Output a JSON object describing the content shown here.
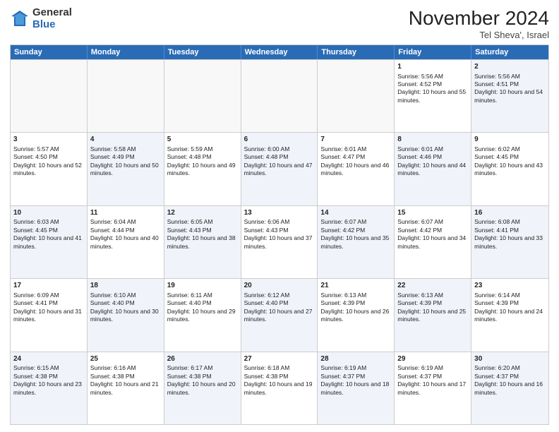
{
  "header": {
    "logo_general": "General",
    "logo_blue": "Blue",
    "title": "November 2024",
    "subtitle": "Tel Sheva', Israel"
  },
  "weekdays": [
    "Sunday",
    "Monday",
    "Tuesday",
    "Wednesday",
    "Thursday",
    "Friday",
    "Saturday"
  ],
  "rows": [
    [
      {
        "day": "",
        "info": "",
        "empty": true
      },
      {
        "day": "",
        "info": "",
        "empty": true
      },
      {
        "day": "",
        "info": "",
        "empty": true
      },
      {
        "day": "",
        "info": "",
        "empty": true
      },
      {
        "day": "",
        "info": "",
        "empty": true
      },
      {
        "day": "1",
        "info": "Sunrise: 5:56 AM\nSunset: 4:52 PM\nDaylight: 10 hours and 55 minutes.",
        "empty": false,
        "alt": false
      },
      {
        "day": "2",
        "info": "Sunrise: 5:56 AM\nSunset: 4:51 PM\nDaylight: 10 hours and 54 minutes.",
        "empty": false,
        "alt": true
      }
    ],
    [
      {
        "day": "3",
        "info": "Sunrise: 5:57 AM\nSunset: 4:50 PM\nDaylight: 10 hours and 52 minutes.",
        "empty": false,
        "alt": false
      },
      {
        "day": "4",
        "info": "Sunrise: 5:58 AM\nSunset: 4:49 PM\nDaylight: 10 hours and 50 minutes.",
        "empty": false,
        "alt": true
      },
      {
        "day": "5",
        "info": "Sunrise: 5:59 AM\nSunset: 4:48 PM\nDaylight: 10 hours and 49 minutes.",
        "empty": false,
        "alt": false
      },
      {
        "day": "6",
        "info": "Sunrise: 6:00 AM\nSunset: 4:48 PM\nDaylight: 10 hours and 47 minutes.",
        "empty": false,
        "alt": true
      },
      {
        "day": "7",
        "info": "Sunrise: 6:01 AM\nSunset: 4:47 PM\nDaylight: 10 hours and 46 minutes.",
        "empty": false,
        "alt": false
      },
      {
        "day": "8",
        "info": "Sunrise: 6:01 AM\nSunset: 4:46 PM\nDaylight: 10 hours and 44 minutes.",
        "empty": false,
        "alt": true
      },
      {
        "day": "9",
        "info": "Sunrise: 6:02 AM\nSunset: 4:45 PM\nDaylight: 10 hours and 43 minutes.",
        "empty": false,
        "alt": false
      }
    ],
    [
      {
        "day": "10",
        "info": "Sunrise: 6:03 AM\nSunset: 4:45 PM\nDaylight: 10 hours and 41 minutes.",
        "empty": false,
        "alt": true
      },
      {
        "day": "11",
        "info": "Sunrise: 6:04 AM\nSunset: 4:44 PM\nDaylight: 10 hours and 40 minutes.",
        "empty": false,
        "alt": false
      },
      {
        "day": "12",
        "info": "Sunrise: 6:05 AM\nSunset: 4:43 PM\nDaylight: 10 hours and 38 minutes.",
        "empty": false,
        "alt": true
      },
      {
        "day": "13",
        "info": "Sunrise: 6:06 AM\nSunset: 4:43 PM\nDaylight: 10 hours and 37 minutes.",
        "empty": false,
        "alt": false
      },
      {
        "day": "14",
        "info": "Sunrise: 6:07 AM\nSunset: 4:42 PM\nDaylight: 10 hours and 35 minutes.",
        "empty": false,
        "alt": true
      },
      {
        "day": "15",
        "info": "Sunrise: 6:07 AM\nSunset: 4:42 PM\nDaylight: 10 hours and 34 minutes.",
        "empty": false,
        "alt": false
      },
      {
        "day": "16",
        "info": "Sunrise: 6:08 AM\nSunset: 4:41 PM\nDaylight: 10 hours and 33 minutes.",
        "empty": false,
        "alt": true
      }
    ],
    [
      {
        "day": "17",
        "info": "Sunrise: 6:09 AM\nSunset: 4:41 PM\nDaylight: 10 hours and 31 minutes.",
        "empty": false,
        "alt": false
      },
      {
        "day": "18",
        "info": "Sunrise: 6:10 AM\nSunset: 4:40 PM\nDaylight: 10 hours and 30 minutes.",
        "empty": false,
        "alt": true
      },
      {
        "day": "19",
        "info": "Sunrise: 6:11 AM\nSunset: 4:40 PM\nDaylight: 10 hours and 29 minutes.",
        "empty": false,
        "alt": false
      },
      {
        "day": "20",
        "info": "Sunrise: 6:12 AM\nSunset: 4:40 PM\nDaylight: 10 hours and 27 minutes.",
        "empty": false,
        "alt": true
      },
      {
        "day": "21",
        "info": "Sunrise: 6:13 AM\nSunset: 4:39 PM\nDaylight: 10 hours and 26 minutes.",
        "empty": false,
        "alt": false
      },
      {
        "day": "22",
        "info": "Sunrise: 6:13 AM\nSunset: 4:39 PM\nDaylight: 10 hours and 25 minutes.",
        "empty": false,
        "alt": true
      },
      {
        "day": "23",
        "info": "Sunrise: 6:14 AM\nSunset: 4:39 PM\nDaylight: 10 hours and 24 minutes.",
        "empty": false,
        "alt": false
      }
    ],
    [
      {
        "day": "24",
        "info": "Sunrise: 6:15 AM\nSunset: 4:38 PM\nDaylight: 10 hours and 23 minutes.",
        "empty": false,
        "alt": true
      },
      {
        "day": "25",
        "info": "Sunrise: 6:16 AM\nSunset: 4:38 PM\nDaylight: 10 hours and 21 minutes.",
        "empty": false,
        "alt": false
      },
      {
        "day": "26",
        "info": "Sunrise: 6:17 AM\nSunset: 4:38 PM\nDaylight: 10 hours and 20 minutes.",
        "empty": false,
        "alt": true
      },
      {
        "day": "27",
        "info": "Sunrise: 6:18 AM\nSunset: 4:38 PM\nDaylight: 10 hours and 19 minutes.",
        "empty": false,
        "alt": false
      },
      {
        "day": "28",
        "info": "Sunrise: 6:19 AM\nSunset: 4:37 PM\nDaylight: 10 hours and 18 minutes.",
        "empty": false,
        "alt": true
      },
      {
        "day": "29",
        "info": "Sunrise: 6:19 AM\nSunset: 4:37 PM\nDaylight: 10 hours and 17 minutes.",
        "empty": false,
        "alt": false
      },
      {
        "day": "30",
        "info": "Sunrise: 6:20 AM\nSunset: 4:37 PM\nDaylight: 10 hours and 16 minutes.",
        "empty": false,
        "alt": true
      }
    ]
  ]
}
